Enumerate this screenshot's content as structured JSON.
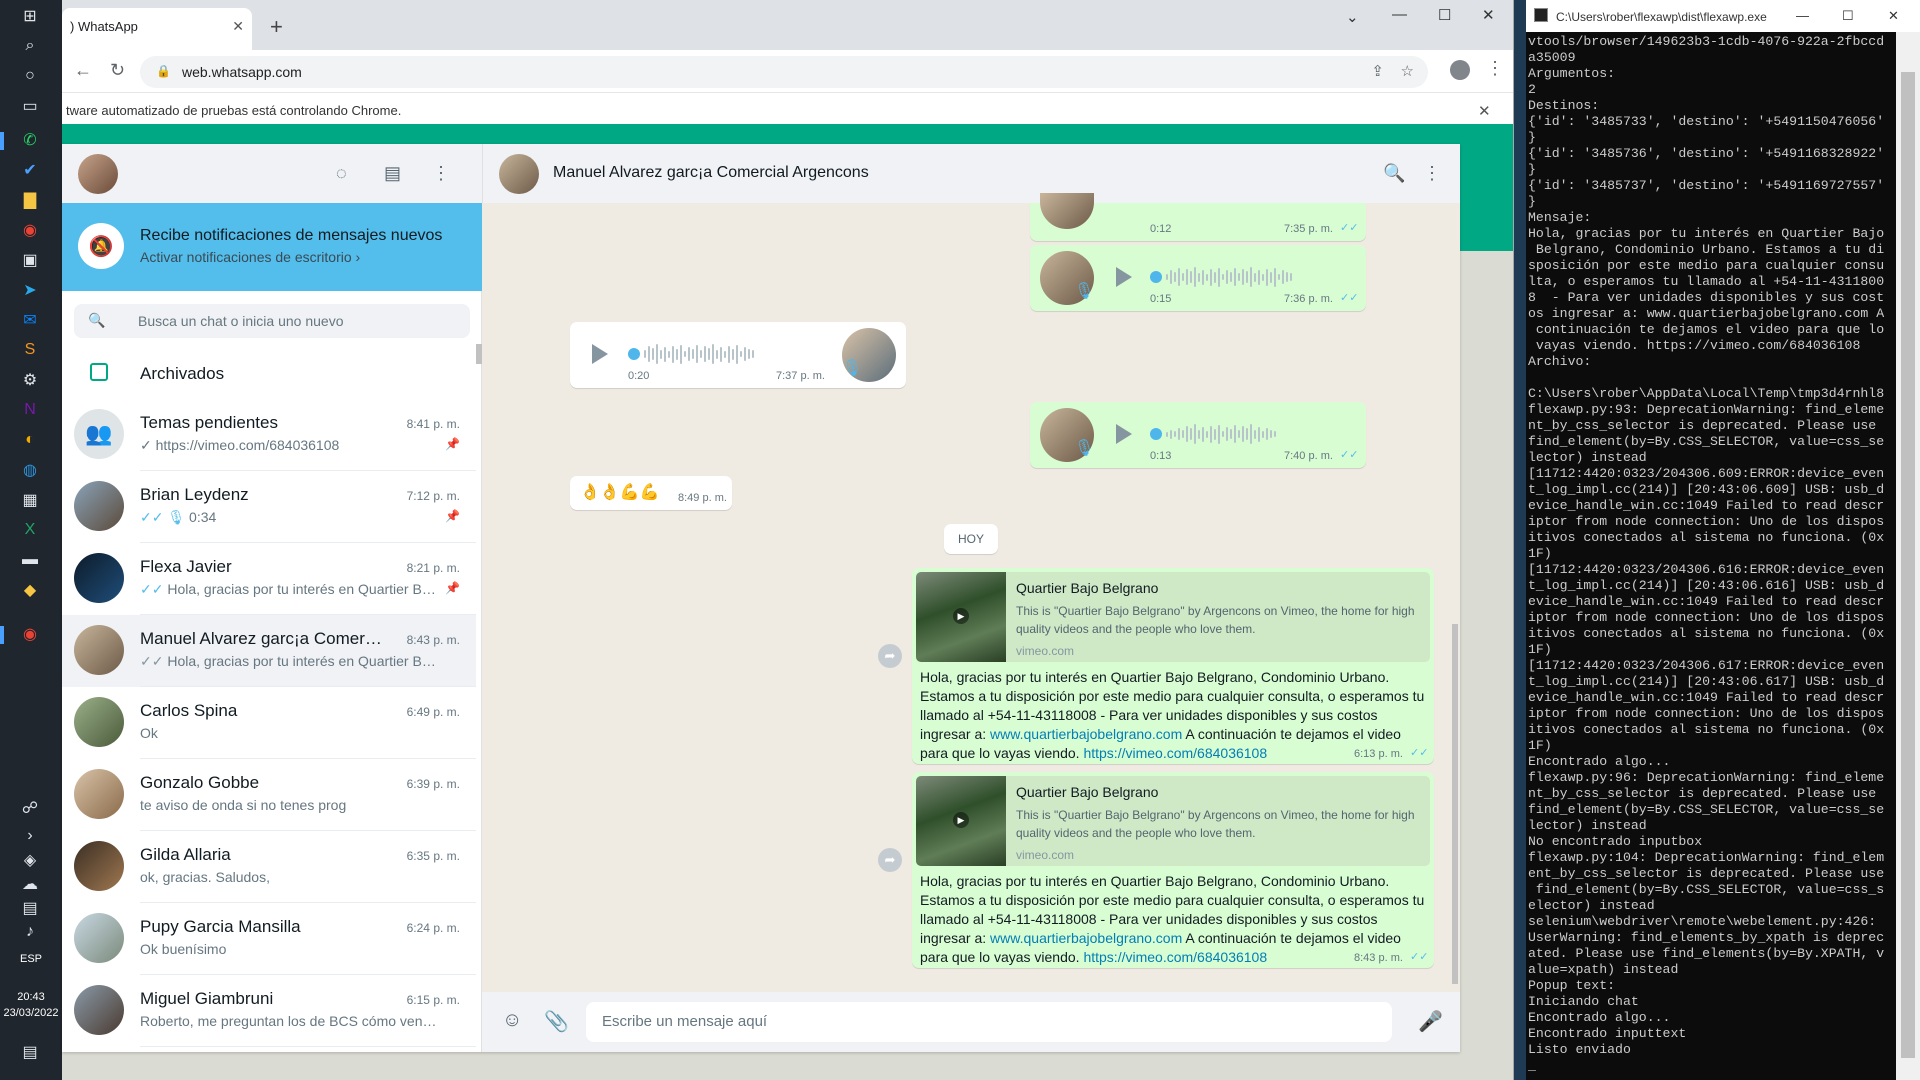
{
  "taskbar": {
    "language": "ESP",
    "time": "20:43",
    "date": "23/03/2022"
  },
  "browser": {
    "tab_title": ") WhatsApp",
    "url": "web.whatsapp.com",
    "infobar": "tware automatizado de pruebas está controlando Chrome."
  },
  "left": {
    "notification_title": "Recibe notificaciones de mensajes nuevos",
    "notification_sub": "Activar notificaciones de escritorio ›",
    "search_placeholder": "Busca un chat o inicia uno nuevo",
    "archived_label": "Archivados",
    "chats": [
      {
        "name": "Temas pendientes",
        "time": "8:41 p. m.",
        "preview": "✓ https://vimeo.com/684036108",
        "pinned": true
      },
      {
        "name": "Brian Leydenz",
        "time": "7:12 p. m.",
        "preview": "0:34",
        "pinned": true
      },
      {
        "name": "Flexa Javier",
        "time": "8:21 p. m.",
        "preview": "Hola, gracias por tu interés en Quartier Bajo...",
        "pinned": true
      },
      {
        "name": "Manuel Alvarez garc¡a Comercia...",
        "time": "8:43 p. m.",
        "preview": "Hola, gracias por tu interés en Quartier Bajo B...",
        "pinned": false
      },
      {
        "name": "Carlos Spina",
        "time": "6:49 p. m.",
        "preview": "Ok",
        "pinned": false
      },
      {
        "name": "Gonzalo Gobbe",
        "time": "6:39 p. m.",
        "preview": "te aviso de onda si no tenes prog",
        "pinned": false
      },
      {
        "name": "Gilda Allaria",
        "time": "6:35 p. m.",
        "preview": "ok, gracias. Saludos,",
        "pinned": false
      },
      {
        "name": "Pupy Garcia Mansilla",
        "time": "6:24 p. m.",
        "preview": "Ok buenísimo",
        "pinned": false
      },
      {
        "name": "Miguel Giambruni",
        "time": "6:15 p. m.",
        "preview": "Roberto, me preguntan los de BCS cómo venís c...",
        "pinned": false
      }
    ]
  },
  "conversation": {
    "title": "Manuel Alvarez garc¡a Comercial Argencons",
    "voice1": {
      "dur": "0:12",
      "time": "7:35 p. m."
    },
    "voice2": {
      "dur": "0:15",
      "time": "7:36 p. m."
    },
    "voice3": {
      "dur": "0:20",
      "time": "7:37 p. m."
    },
    "voice4": {
      "dur": "0:13",
      "time": "7:40 p. m."
    },
    "emoji_msg": {
      "text": "👌👌💪💪",
      "time": "8:49 p. m."
    },
    "day_badge": "HOY",
    "link1": {
      "title": "Quartier Bajo Belgrano",
      "desc": "This is \"Quartier Bajo Belgrano\" by Argencons on Vimeo, the home for high quality videos and the people who love them.",
      "site": "vimeo.com",
      "text_a": "Hola, gracias por tu interés en Quartier Bajo Belgrano, Condominio Urbano. Estamos a tu disposición por este medio para cualquier consulta, o esperamos tu llamado al +54-11-43118008  - Para ver unidades disponibles y sus costos ingresar a: ",
      "link_site": "www.quartierbajobelgrano.com",
      "text_b": " A continuación te dejamos el video para que lo vayas viendo. ",
      "link_video": "https://vimeo.com/684036108",
      "time": "6:13 p. m."
    },
    "link2": {
      "title": "Quartier Bajo Belgrano",
      "desc": "This is \"Quartier Bajo Belgrano\" by Argencons on Vimeo, the home for high quality videos and the people who love them.",
      "site": "vimeo.com",
      "text_a": "Hola, gracias por tu interés en Quartier Bajo Belgrano, Condominio Urbano. Estamos a tu disposición por este medio para cualquier consulta, o esperamos tu llamado al +54-11-43118008  - Para ver unidades disponibles y sus costos ingresar a: ",
      "link_site": "www.quartierbajobelgrano.com",
      "text_b": " A continuación te dejamos el video para que lo vayas viendo. ",
      "link_video": "https://vimeo.com/684036108",
      "time": "8:43 p. m."
    },
    "composer_placeholder": "Escribe un mensaje aquí"
  },
  "console": {
    "title": "C:\\Users\\rober\\flexawp\\dist\\flexawp.exe",
    "text": "vtools/browser/149623b3-1cdb-4076-922a-2fbccd\na35009\nArgumentos:\n2\nDestinos:\n{'id': '3485733', 'destino': '+5491150476056'\n}\n{'id': '3485736', 'destino': '+5491168328922'\n}\n{'id': '3485737', 'destino': '+5491169727557'\n}\nMensaje:\nHola, gracias por tu interés en Quartier Bajo\n Belgrano, Condominio Urbano. Estamos a tu di\nsposición por este medio para cualquier consu\nlta, o esperamos tu llamado al +54-11-4311800\n8  - Para ver unidades disponibles y sus cost\nos ingresar a: www.quartierbajobelgrano.com A\n continuación te dejamos el video para que lo\n vayas viendo. https://vimeo.com/684036108\nArchivo:\n\nC:\\Users\\rober\\AppData\\Local\\Temp\\tmp3d4rnhl8\nflexawp.py:93: DeprecationWarning: find_eleme\nnt_by_css_selector is deprecated. Please use\nfind_element(by=By.CSS_SELECTOR, value=css_se\nlector) instead\n[11712:4420:0323/204306.609:ERROR:device_even\nt_log_impl.cc(214)] [20:43:06.609] USB: usb_d\nevice_handle_win.cc:1049 Failed to read descr\niptor from node connection: Uno de los dispos\nitivos conectados al sistema no funciona. (0x\n1F)\n[11712:4420:0323/204306.616:ERROR:device_even\nt_log_impl.cc(214)] [20:43:06.616] USB: usb_d\nevice_handle_win.cc:1049 Failed to read descr\niptor from node connection: Uno de los dispos\nitivos conectados al sistema no funciona. (0x\n1F)\n[11712:4420:0323/204306.617:ERROR:device_even\nt_log_impl.cc(214)] [20:43:06.617] USB: usb_d\nevice_handle_win.cc:1049 Failed to read descr\niptor from node connection: Uno de los dispos\nitivos conectados al sistema no funciona. (0x\n1F)\nEncontrado algo...\nflexawp.py:96: DeprecationWarning: find_eleme\nnt_by_css_selector is deprecated. Please use\nfind_element(by=By.CSS_SELECTOR, value=css_se\nlector) instead\nNo encontrado inputbox\nflexawp.py:104: DeprecationWarning: find_elem\nent_by_css_selector is deprecated. Please use\n find_element(by=By.CSS_SELECTOR, value=css_s\nelector) instead\nselenium\\webdriver\\remote\\webelement.py:426:\nUserWarning: find_elements_by_xpath is deprec\nated. Please use find_elements(by=By.XPATH, v\nalue=xpath) instead\nPopup text:\nIniciando chat\nEncontrado algo...\nEncontrado inputtext\nListo enviado\n_"
  }
}
